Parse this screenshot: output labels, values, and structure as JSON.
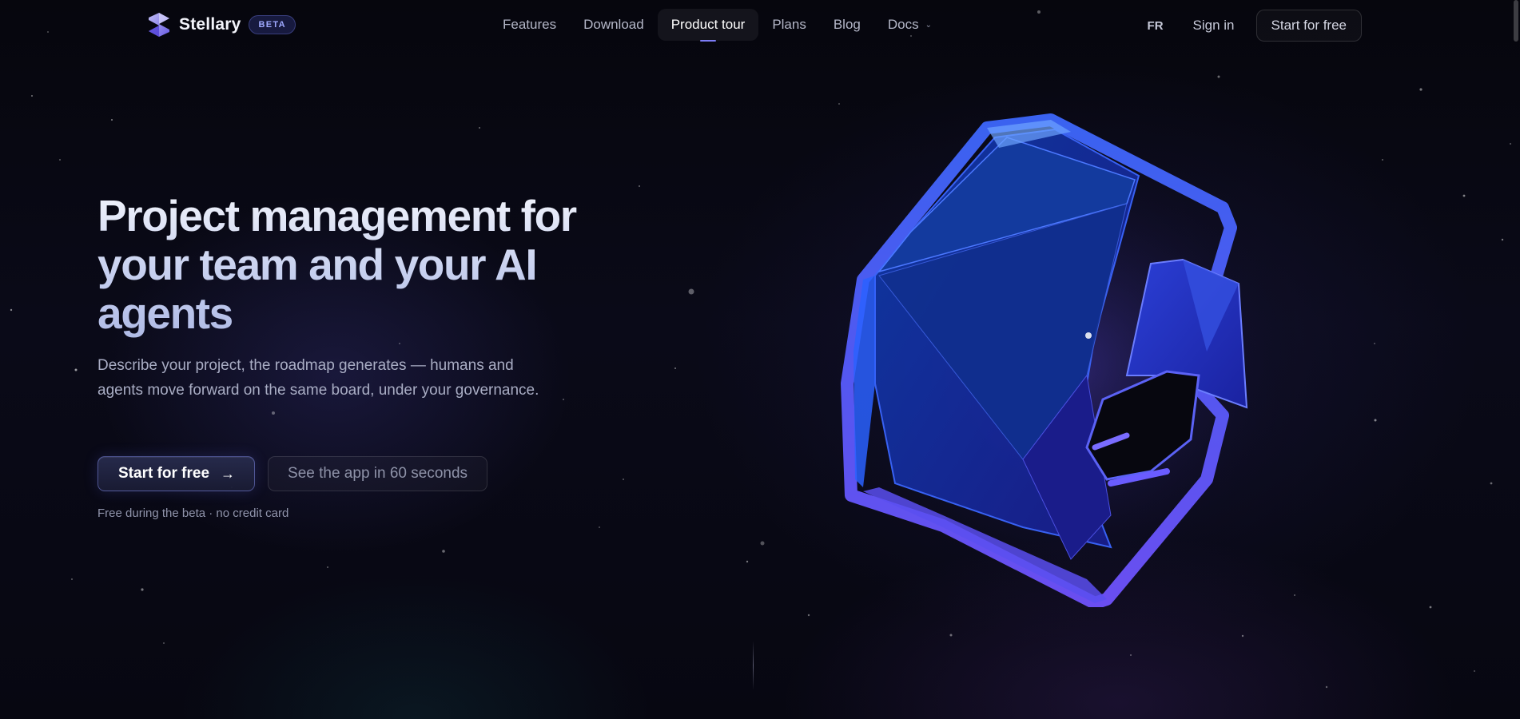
{
  "brand": {
    "name": "Stellary",
    "badge": "BETA",
    "logo_icon": "stellary-s-logo-icon"
  },
  "nav": {
    "links": [
      {
        "label": "Features"
      },
      {
        "label": "Download"
      },
      {
        "label": "Product tour",
        "active": true
      },
      {
        "label": "Plans"
      },
      {
        "label": "Blog"
      },
      {
        "label": "Docs",
        "icon": "chevron-down-icon"
      }
    ],
    "language": "FR",
    "sign_in": "Sign in",
    "cta": "Start for free"
  },
  "hero": {
    "title_line1": "Project management for",
    "title_line2": "your team and your AI",
    "title_line3": "agents",
    "subtitle": "Describe your project, the roadmap generates — humans and agents move forward on the same board, under your governance.",
    "primary_cta": "Start for free",
    "primary_cta_icon": "arrow-right-icon",
    "secondary_cta": "See the app in 60 seconds",
    "note": "Free during the beta · no credit card",
    "illustration": "blue-crystal-polyhedron-illustration"
  },
  "colors": {
    "background": "#07070f",
    "accent": "#7c7cf5",
    "crystal_blue": "#2a45d8",
    "crystal_violet": "#6a4ef0"
  }
}
